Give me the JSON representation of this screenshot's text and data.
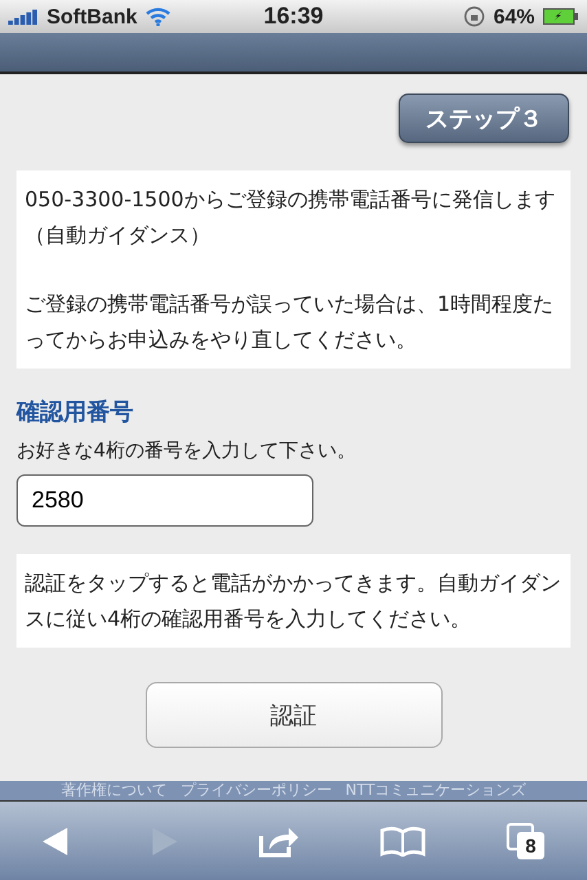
{
  "status_bar": {
    "carrier": "SoftBank",
    "time": "16:39",
    "battery": "64%"
  },
  "step_button": "ステップ３",
  "info": [
    "050-3300-1500からご登録の携帯電話番号に発信します",
    "（自動ガイダンス）",
    "ご登録の携帯電話番号が誤っていた場合は、1時間程度たってからお申込みをやり直してください。"
  ],
  "field_label": "確認用番号",
  "field_hint": "お好きな4桁の番号を入力して下さい。",
  "field_value": "2580",
  "note": "認証をタップすると電話がかかってきます。自動ガイダンスに従い4桁の確認用番号を入力してください。",
  "submit_button": "認証",
  "footer_links": [
    "著作権について",
    "プライバシーポリシー",
    "NTTコミュニケーションズ"
  ],
  "toolbar": {
    "back_disabled": false,
    "forward_disabled": true,
    "tab_count": "8"
  }
}
